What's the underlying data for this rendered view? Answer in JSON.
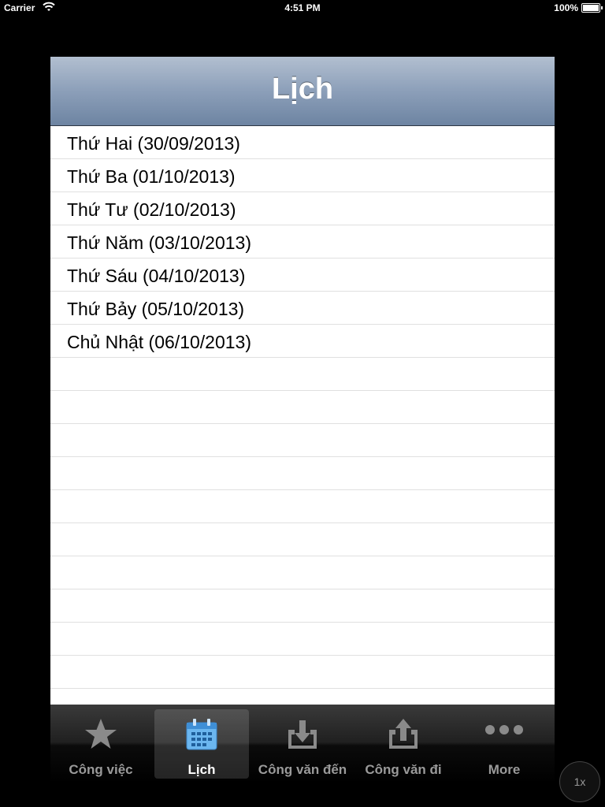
{
  "status_bar": {
    "carrier": "Carrier",
    "time": "4:51 PM",
    "battery": "100%"
  },
  "nav": {
    "title": "Lịch"
  },
  "days": [
    "Thứ Hai (30/09/2013)",
    "Thứ Ba (01/10/2013)",
    "Thứ Tư (02/10/2013)",
    "Thứ Năm (03/10/2013)",
    "Thứ Sáu (04/10/2013)",
    "Thứ Bảy (05/10/2013)",
    "Chủ Nhật (06/10/2013)"
  ],
  "tabs": [
    {
      "label": "Công việc",
      "icon": "star-icon",
      "selected": false
    },
    {
      "label": "Lịch",
      "icon": "calendar-icon",
      "selected": true
    },
    {
      "label": "Công văn đến",
      "icon": "inbox-download-icon",
      "selected": false
    },
    {
      "label": "Công văn đi",
      "icon": "outbox-upload-icon",
      "selected": false
    },
    {
      "label": "More",
      "icon": "more-dots-icon",
      "selected": false
    }
  ],
  "zoom_button": "1x",
  "colors": {
    "nav_gradient_top": "#b2bfd0",
    "nav_gradient_bottom": "#6d84a2",
    "tab_selected_icon": "#5fa9e6",
    "tab_unselected": "#9a9a9a"
  }
}
